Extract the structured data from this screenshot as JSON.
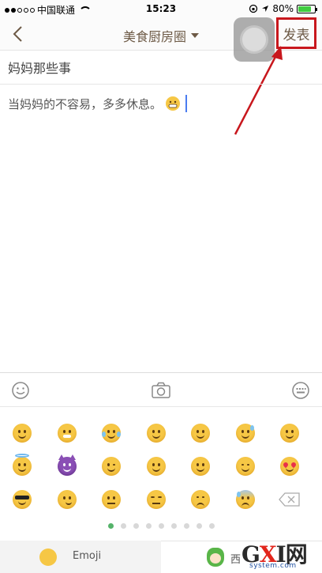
{
  "status_bar": {
    "carrier": "中国联通",
    "time": "15:23",
    "battery_percent": "80%",
    "battery_level": 0.8,
    "battery_color": "#3fcc3f"
  },
  "nav": {
    "back_icon": "chevron-left-icon",
    "title": "美食厨房圈",
    "publish_label": "发表",
    "highlight_color": "#c8171d"
  },
  "editor": {
    "title_text": "妈妈那些事",
    "body_text": "当妈妈的不容易，多多休息。",
    "cursor_color": "#4a7cf0"
  },
  "toolbar": {
    "icons": [
      "smiley-icon",
      "camera-icon",
      "keyboard-icon"
    ]
  },
  "emoji_panel": {
    "rows": [
      [
        "grinning-face",
        "grimacing-face",
        "tears-of-joy-face",
        "smiley-face",
        "smile-face",
        "sweat-smile-face",
        "laughing-face"
      ],
      [
        "halo-face",
        "devil-face",
        "wink-face",
        "blush-face",
        "yum-face",
        "relieved-face",
        "heart-eyes-face"
      ],
      [
        "sunglasses-face",
        "smirk-face",
        "neutral-face",
        "expressionless-face",
        "unamused-face",
        "cold-sweat-face",
        "delete-key"
      ]
    ],
    "page_count": 9,
    "active_page": 1,
    "active_color": "#55b36a"
  },
  "bottom_tabs": {
    "emoji_label": "Emoji",
    "west_label": "西"
  },
  "watermark": {
    "brand": "GXI网",
    "domain": "system.com"
  }
}
